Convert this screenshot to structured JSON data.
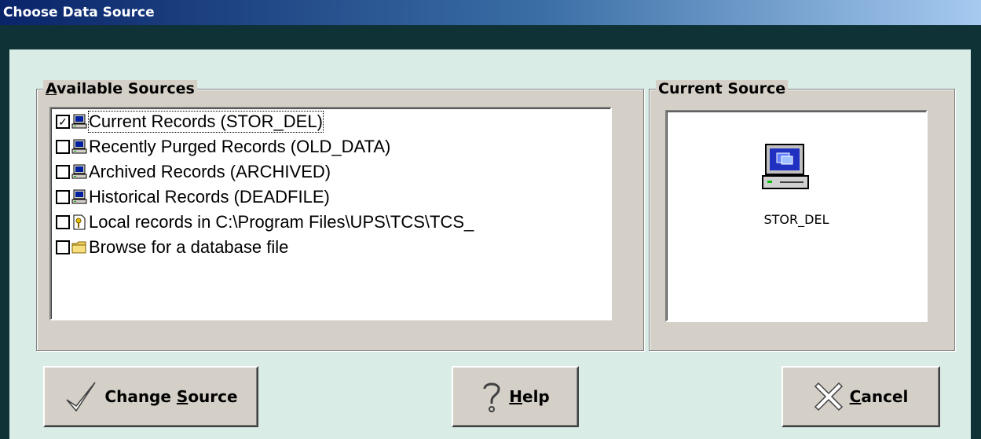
{
  "window": {
    "title": "Choose Data Source"
  },
  "available": {
    "label_accel": "A",
    "label_rest": "vailable Sources",
    "items": [
      {
        "label": "Current Records (STOR_DEL)",
        "checked": true,
        "icon": "computer-icon"
      },
      {
        "label": "Recently Purged Records (OLD_DATA)",
        "checked": false,
        "icon": "computer-icon"
      },
      {
        "label": "Archived Records (ARCHIVED)",
        "checked": false,
        "icon": "computer-icon"
      },
      {
        "label": "Historical Records (DEADFILE)",
        "checked": false,
        "icon": "computer-icon"
      },
      {
        "label": "Local records in C:\\Program Files\\UPS\\TCS\\TCS_",
        "checked": false,
        "icon": "local-db-icon"
      },
      {
        "label": "Browse for a database file",
        "checked": false,
        "icon": "folder-icon"
      }
    ]
  },
  "current": {
    "label": "Current Source",
    "source_name": "STOR_DEL"
  },
  "buttons": {
    "change": {
      "pre": "Change ",
      "accel": "S",
      "post": "ource"
    },
    "help": {
      "pre": "",
      "accel": "H",
      "post": "elp"
    },
    "cancel": {
      "pre": "",
      "accel": "C",
      "post": "ancel"
    }
  }
}
